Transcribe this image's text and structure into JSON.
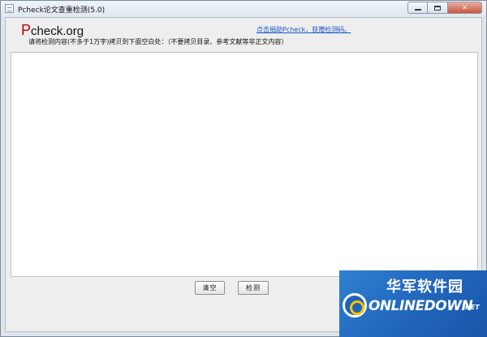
{
  "window": {
    "title": "Pcheck论文查重检测(5.0)",
    "close_glyph": "✕",
    "icons": {
      "app": "app-window-icon",
      "minimize": "minimize-icon",
      "maximize": "maximize-icon",
      "close": "close-icon"
    }
  },
  "header": {
    "logo_first": "P",
    "logo_rest": "check.org",
    "donate_link": "点击捐助Pcheck，获赠检测码。",
    "instruction": "请将检测内容(不多于1万字)拷贝到下面空白处：（不要拷贝目录、参考文献等非正文内容）"
  },
  "editor": {
    "value": "",
    "placeholder": ""
  },
  "buttons": {
    "clear": "清空",
    "check": "检测"
  },
  "watermark": {
    "cn": "华军软件园",
    "en": "ONLINEDOWN",
    "net": ".NET"
  },
  "colors": {
    "logo_accent": "#c80000",
    "link": "#1a56c8",
    "watermark_bg": "#1f63b8"
  }
}
